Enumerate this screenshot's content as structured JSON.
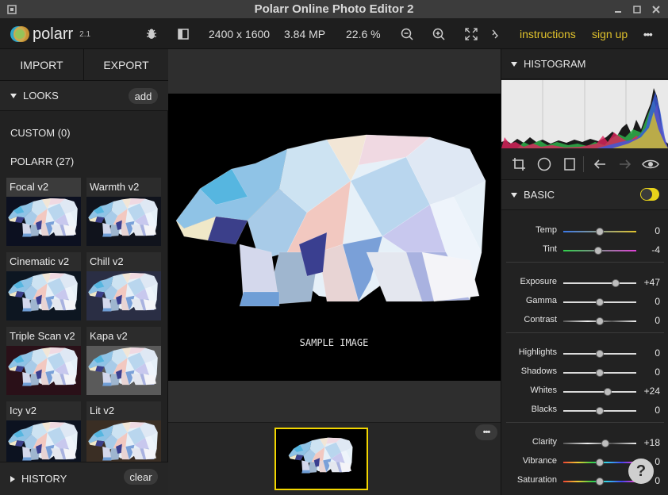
{
  "window": {
    "title": "Polarr Online Photo Editor 2"
  },
  "toolbar": {
    "logo_text": "polarr",
    "version": "2.1",
    "dimensions": "2400 x 1600",
    "megapixels": "3.84 MP",
    "zoom": "22.6 %",
    "instructions_label": "instructions",
    "signup_label": "sign up",
    "more_label": "•••"
  },
  "left": {
    "import_label": "IMPORT",
    "export_label": "EXPORT",
    "looks_label": "LOOKS",
    "add_label": "add",
    "custom_label": "CUSTOM (0)",
    "polarr_label": "POLARR (27)",
    "looks": [
      {
        "name": "Focal v2",
        "tint": "#0c1020"
      },
      {
        "name": "Warmth v2",
        "tint": "#10131c"
      },
      {
        "name": "Cinematic v2",
        "tint": "#0d1621"
      },
      {
        "name": "Chill v2",
        "tint": "#2a2e44"
      },
      {
        "name": "Triple Scan v2",
        "tint": "#2a1018"
      },
      {
        "name": "Kapa v2",
        "tint": "#5a5a5a"
      },
      {
        "name": "Icy v2",
        "tint": "#0c1220"
      },
      {
        "name": "Lit v2",
        "tint": "#3a2e24"
      }
    ],
    "history_label": "HISTORY",
    "clear_label": "clear"
  },
  "canvas": {
    "sample_label": "SAMPLE IMAGE"
  },
  "filmstrip": {
    "more_label": "•••"
  },
  "right": {
    "histogram_label": "HISTOGRAM",
    "basic_label": "BASIC",
    "help_label": "?",
    "sliders": [
      {
        "label": "Temp",
        "value": "0",
        "level": 0.5,
        "track": "temp"
      },
      {
        "label": "Tint",
        "value": "-4",
        "level": 0.48,
        "track": "tint"
      },
      {
        "label": "Exposure",
        "value": "+47",
        "level": 0.72,
        "track": "plain"
      },
      {
        "label": "Gamma",
        "value": "0",
        "level": 0.5,
        "track": "plain"
      },
      {
        "label": "Contrast",
        "value": "0",
        "level": 0.5,
        "track": "contrast"
      },
      {
        "label": "Highlights",
        "value": "0",
        "level": 0.5,
        "track": "plain"
      },
      {
        "label": "Shadows",
        "value": "0",
        "level": 0.5,
        "track": "plain"
      },
      {
        "label": "Whites",
        "value": "+24",
        "level": 0.61,
        "track": "plain"
      },
      {
        "label": "Blacks",
        "value": "0",
        "level": 0.5,
        "track": "plain"
      },
      {
        "label": "Clarity",
        "value": "+18",
        "level": 0.58,
        "track": "contrast"
      },
      {
        "label": "Vibrance",
        "value": "0",
        "level": 0.5,
        "track": "rainbow"
      },
      {
        "label": "Saturation",
        "value": "0",
        "level": 0.5,
        "track": "rainbow"
      }
    ]
  },
  "colors": {
    "accent": "#e0c22c",
    "toggle": "#e8d31a",
    "selected_border": "#f2d600"
  }
}
